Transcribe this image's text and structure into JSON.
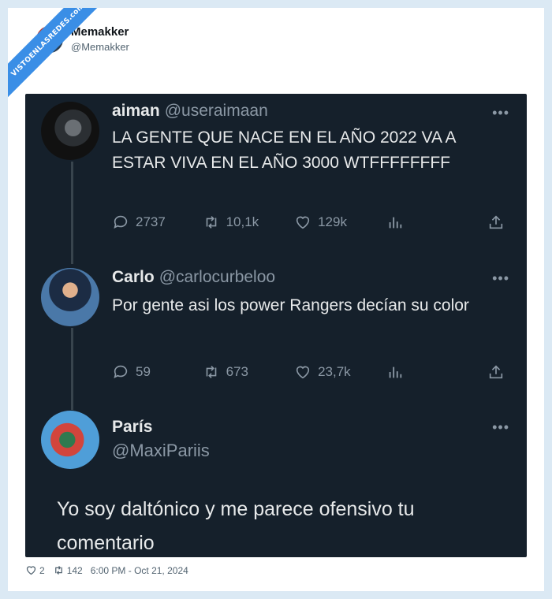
{
  "brand": {
    "watermark": "VISTOENLASREDES.com"
  },
  "post": {
    "author_name": "Memakker",
    "author_handle": "@Memakker",
    "likes": "2",
    "reposts": "142",
    "timestamp": "6:00 PM - Oct 21, 2024"
  },
  "screenshot": {
    "tweets": [
      {
        "name": "aiman",
        "handle": "@useraimaan",
        "text": "LA GENTE QUE NACE EN EL AÑO 2022 VA A ESTAR VIVA EN EL AÑO 3000 WTFFFFFFFF",
        "replies": "2737",
        "retweets": "10,1k",
        "likes": "129k"
      },
      {
        "name": "Carlo",
        "handle": "@carlocurbeloo",
        "text": "Por gente asi los power Rangers decían su color",
        "replies": "59",
        "retweets": "673",
        "likes": "23,7k"
      },
      {
        "name": "París",
        "handle": "@MaxiPariis",
        "text": "Yo soy daltónico y me parece ofensivo tu comentario"
      }
    ],
    "more_label": "•••"
  },
  "colors": {
    "dark_bg": "#15202b",
    "text": "#e7e9ea",
    "muted": "#8b98a5",
    "watermark": "#3a8ee6"
  }
}
